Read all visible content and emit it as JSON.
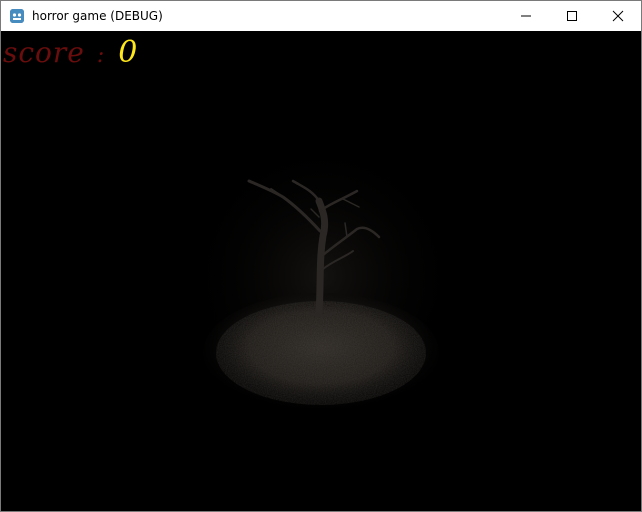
{
  "window": {
    "title": "horror game (DEBUG)",
    "app_icon": "godot-engine-icon",
    "controls": [
      "minimize-icon",
      "maximize-icon",
      "close-icon"
    ]
  },
  "hud": {
    "score_label": "score",
    "separator": ":",
    "score_value": "0",
    "colors": {
      "label": "#6a0d0d",
      "value": "#ffe81a"
    }
  },
  "scene": {
    "background": "#000000",
    "objects": [
      "dead-tree",
      "dirt-ground-patch"
    ]
  }
}
